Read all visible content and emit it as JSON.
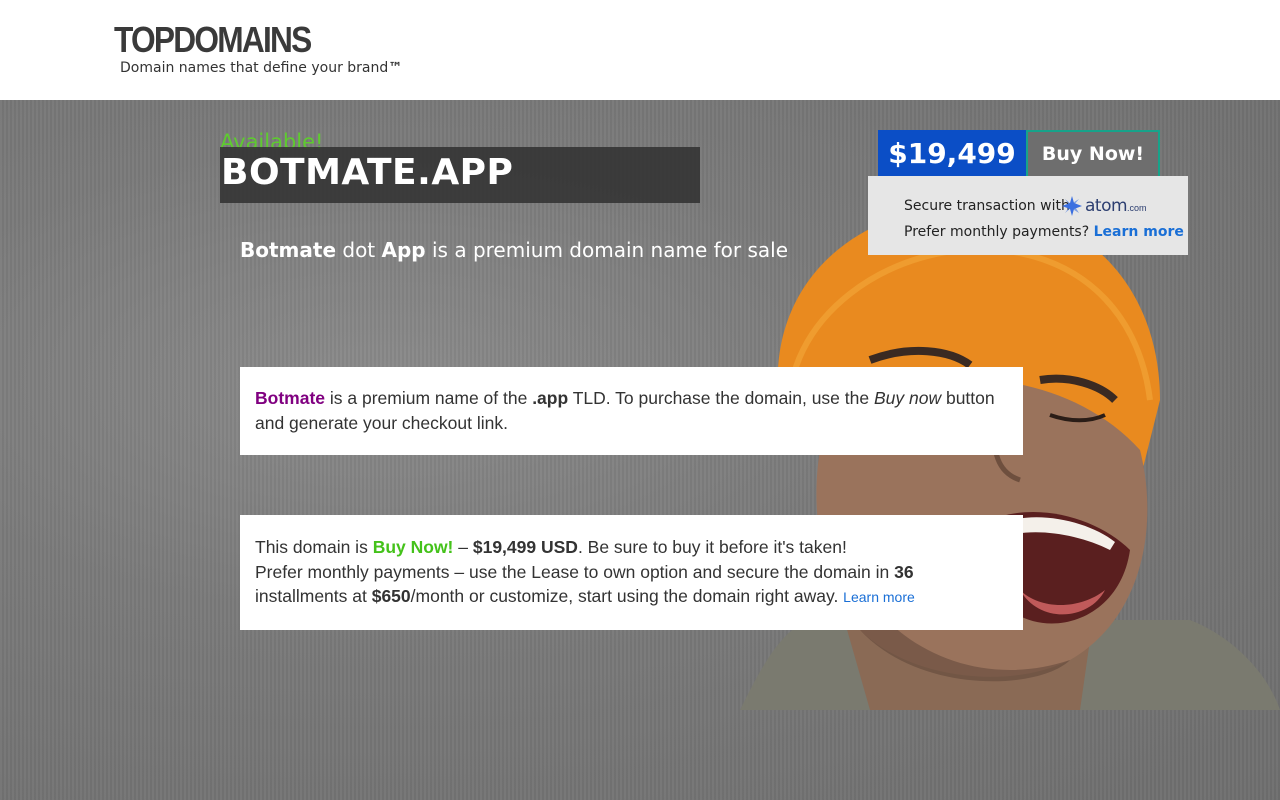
{
  "header": {
    "logo": "TOPDOMAINS",
    "tagline": "Domain names that define your brand",
    "tagline_tm": "™"
  },
  "hero": {
    "available": "Available!",
    "domain": "BOTMATE.APP",
    "subtitle_name": "Botmate",
    "subtitle_dot": " dot ",
    "subtitle_tld": "App",
    "subtitle_rest": " is a premium domain name for sale"
  },
  "purchase": {
    "price": "$19,499",
    "buy_label": "Buy Now!",
    "secure_text": "Secure transaction with",
    "atom_text": "atom",
    "atom_suffix": ".com",
    "monthly_text": "Prefer monthly payments?",
    "learn_more": "Learn more"
  },
  "card1": {
    "name": "Botmate",
    "t1": " is a premium name of the ",
    "tld": ".app",
    "t2": " TLD. To purchase the domain, use the ",
    "buy_now": "Buy now",
    "t3": " button and generate your checkout link."
  },
  "card2": {
    "t1": "This domain is ",
    "buy_now": "Buy Now!",
    "t2": " – ",
    "price": "$19,499 USD",
    "t3": ". Be sure to buy it before it's taken!",
    "t4": "Prefer monthly payments – use the Lease to own option and secure the domain in ",
    "months": "36",
    "t5": " installments at ",
    "monthly": "$650",
    "t6": "/month or customize, start using the domain right away. ",
    "learn_more": "Learn more"
  },
  "colors": {
    "price_bg": "#0b4ec6",
    "available_green": "#5ecb2f",
    "accent_purple": "#800080",
    "link_blue": "#1a6fd6",
    "buy_border": "#17a38a"
  }
}
